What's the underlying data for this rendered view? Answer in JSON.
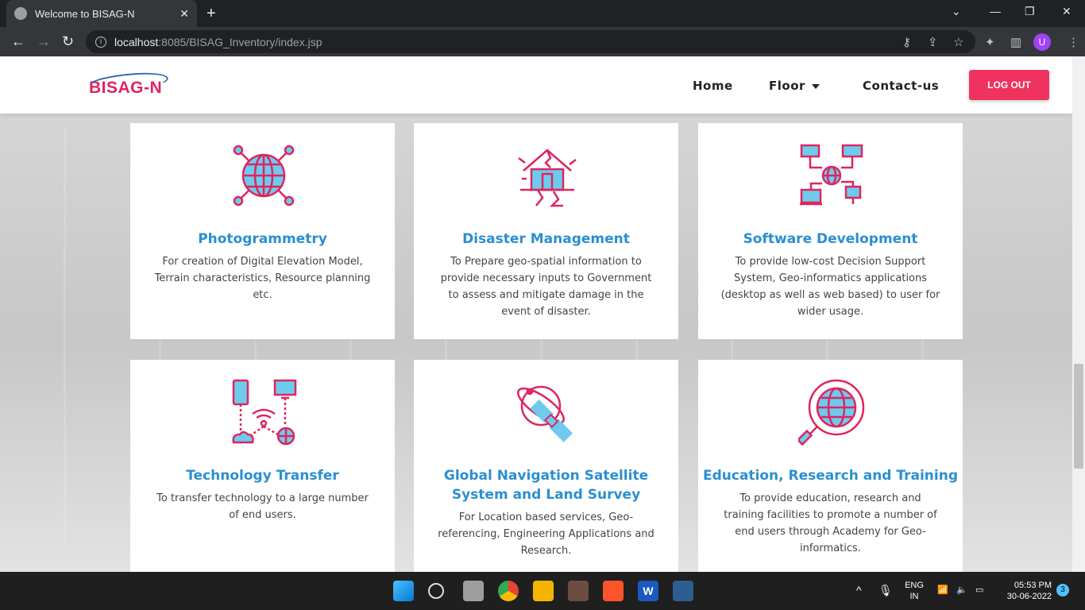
{
  "browser": {
    "tab_title": "Welcome to BISAG-N",
    "tab_close": "✕",
    "new_tab": "+",
    "url_host": "localhost",
    "url_rest": ":8085/BISAG_Inventory/index.jsp",
    "profile_initial": "U"
  },
  "site": {
    "logo_text": "BISAG-N",
    "nav": {
      "home": "Home",
      "floor": "Floor",
      "contact": "Contact-us"
    },
    "logout_label": "LOG OUT"
  },
  "cards": [
    {
      "title": "Photogrammetry",
      "description": "For creation of Digital Elevation Model, Terrain characteristics, Resource planning etc.",
      "icon": "globe-network-icon"
    },
    {
      "title": "Disaster Management",
      "description": "To Prepare geo-spatial information to provide necessary inputs to Government to assess and mitigate damage in the event of disaster.",
      "icon": "damaged-house-icon"
    },
    {
      "title": "Software Development",
      "description": "To provide low-cost Decision Support System, Geo-informatics applications (desktop as well as web based) to user for wider usage.",
      "icon": "computer-network-icon"
    },
    {
      "title": "Technology Transfer",
      "description": "To transfer technology to a large number of end users.",
      "icon": "device-transfer-icon"
    },
    {
      "title": "Global Navigation Satellite System and Land Survey",
      "description": "For Location based services, Geo-referencing, Engineering Applications and Research.",
      "icon": "satellite-orbit-icon"
    },
    {
      "title": "Education, Research and Training",
      "description": "To provide education, research and training facilities to promote a number of end users through Academy for Geo-informatics.",
      "icon": "globe-magnifier-icon"
    }
  ],
  "taskbar": {
    "lang_line1": "ENG",
    "lang_line2": "IN",
    "time": "05:53 PM",
    "date": "30-06-2022",
    "notification_count": "3"
  },
  "colors": {
    "accent_pink": "#f0325e",
    "title_blue": "#2a8fd0",
    "icon_blue": "#6ecbee"
  }
}
